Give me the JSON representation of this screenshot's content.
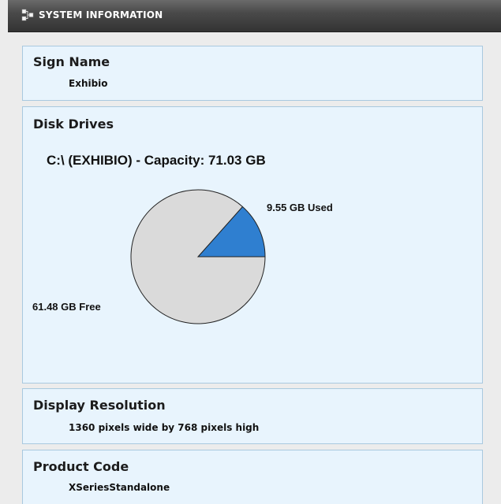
{
  "window": {
    "title": "SYSTEM INFORMATION"
  },
  "sign": {
    "heading": "Sign Name",
    "value": "Exhibio"
  },
  "disk": {
    "heading": "Disk Drives",
    "capacity_line": "C:\\ (EXHIBIO) - Capacity: 71.03 GB",
    "used_label": "9.55 GB Used",
    "free_label": "61.48 GB Free"
  },
  "display": {
    "heading": "Display Resolution",
    "value": "1360 pixels wide by 768 pixels high"
  },
  "product": {
    "heading": "Product Code",
    "value": "XSeriesStandalone"
  },
  "chart_data": {
    "type": "pie",
    "title": "C:\\ (EXHIBIO) - Capacity: 71.03 GB",
    "categories": [
      "Used",
      "Free"
    ],
    "values": [
      9.55,
      61.48
    ],
    "labels": [
      "9.55 GB Used",
      "61.48 GB Free"
    ],
    "colors": [
      "#2f7fd0",
      "#dadada"
    ],
    "unit": "GB"
  },
  "colors": {
    "titlebar": "#444444",
    "panel_background": "#e8f4fd",
    "panel_border": "#a9c9df",
    "used_slice": "#2f7fd0",
    "free_slice": "#dadada"
  }
}
